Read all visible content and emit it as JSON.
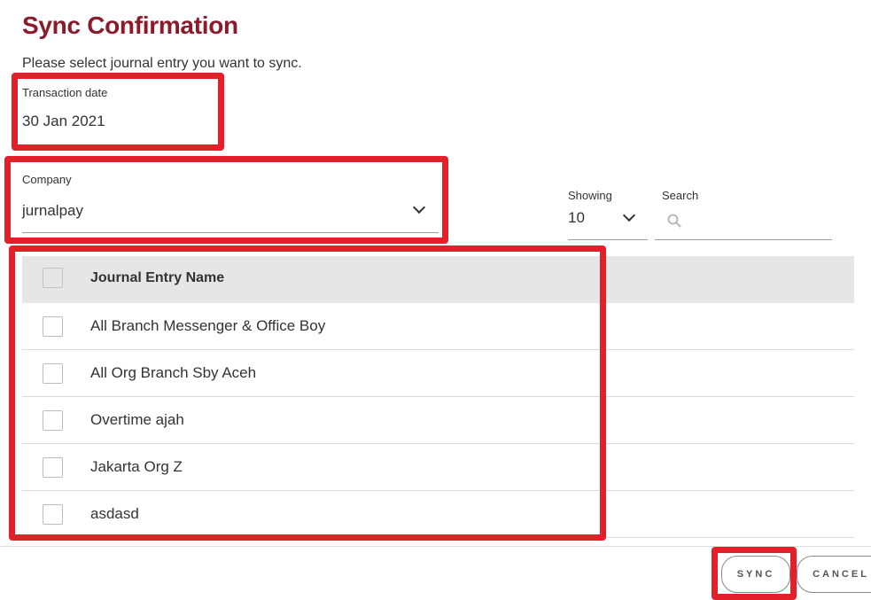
{
  "header": {
    "title": "Sync Confirmation",
    "subtitle": "Please select journal entry you want to sync."
  },
  "transaction_date": {
    "label": "Transaction date",
    "value": "30 Jan 2021"
  },
  "company": {
    "label": "Company",
    "value": "jurnalpay"
  },
  "showing": {
    "label": "Showing",
    "value": "10"
  },
  "search": {
    "label": "Search",
    "placeholder": ""
  },
  "table": {
    "header": "Journal Entry Name",
    "rows": [
      "All Branch Messenger & Office Boy",
      "All Org Branch Sby Aceh",
      "Overtime ajah",
      "Jakarta Org Z",
      "asdasd"
    ]
  },
  "buttons": {
    "sync": "SYNC",
    "cancel": "CANCEL"
  },
  "colors": {
    "title": "#8b1a2b",
    "highlight": "#e3202a",
    "table_header_bg": "#e6e6e6"
  }
}
